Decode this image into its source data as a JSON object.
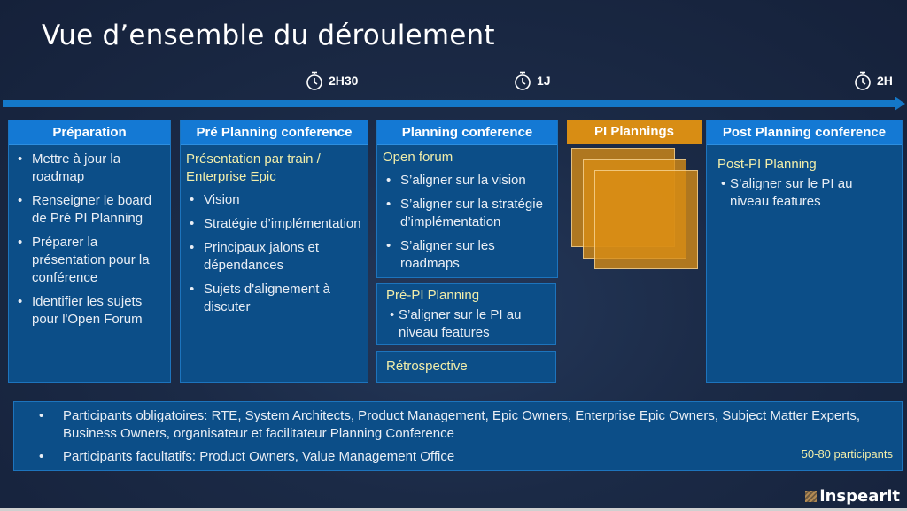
{
  "title": "Vue d’ensemble du déroulement",
  "timeline": {
    "markers": [
      {
        "icon": "stopwatch-icon",
        "label": "2H30"
      },
      {
        "icon": "stopwatch-icon",
        "label": "1J"
      },
      {
        "icon": "stopwatch-icon",
        "label": "2H"
      }
    ],
    "color": "#1478c8"
  },
  "phases": {
    "preparation": {
      "header": "Préparation",
      "bullets": [
        "Mettre à jour la roadmap",
        "Renseigner le board de Pré PI Planning",
        "Préparer la présentation pour la conférence",
        "Identifier les sujets pour l'Open Forum"
      ]
    },
    "pre_planning": {
      "header": "Pré Planning conference",
      "subhead": "Présentation par train / Enterprise Epic",
      "bullets": [
        "Vision",
        "Stratégie d’implémentation",
        "Principaux jalons et dépendances",
        "Sujets d'alignement à discuter"
      ]
    },
    "planning": {
      "header": "Planning conference",
      "open_forum": {
        "subhead": "Open forum",
        "bullets": [
          "S’aligner sur la vision",
          "S’aligner sur la stratégie d’implémentation",
          "S’aligner sur les roadmaps"
        ]
      },
      "pre_pi": {
        "subhead": "Pré-PI Planning",
        "bullets": [
          "S’aligner sur le PI au niveau features"
        ]
      },
      "retro": {
        "subhead": "Rétrospective"
      }
    },
    "pi_plannings": {
      "header": "PI Plannings",
      "color": "#d88d14"
    },
    "post_planning": {
      "header": "Post Planning conference",
      "subhead": "Post-PI Planning",
      "bullets": [
        "S’aligner sur le PI au niveau features"
      ]
    }
  },
  "participants": {
    "bullets": [
      "Participants obligatoires: RTE, System Architects, Product Management, Epic Owners, Enterprise Epic Owners, Subject Matter Experts, Business Owners, organisateur et facilitateur Planning Conference",
      "Participants facultatifs: Product Owners, Value Management Office"
    ],
    "count": "50-80 participants"
  },
  "logo": "inspearit",
  "colors": {
    "background": "#1b2a46",
    "box": "#0c4e88",
    "header": "#1479d4",
    "subhead": "#f2eeaa",
    "accent_orange": "#d88d14"
  }
}
